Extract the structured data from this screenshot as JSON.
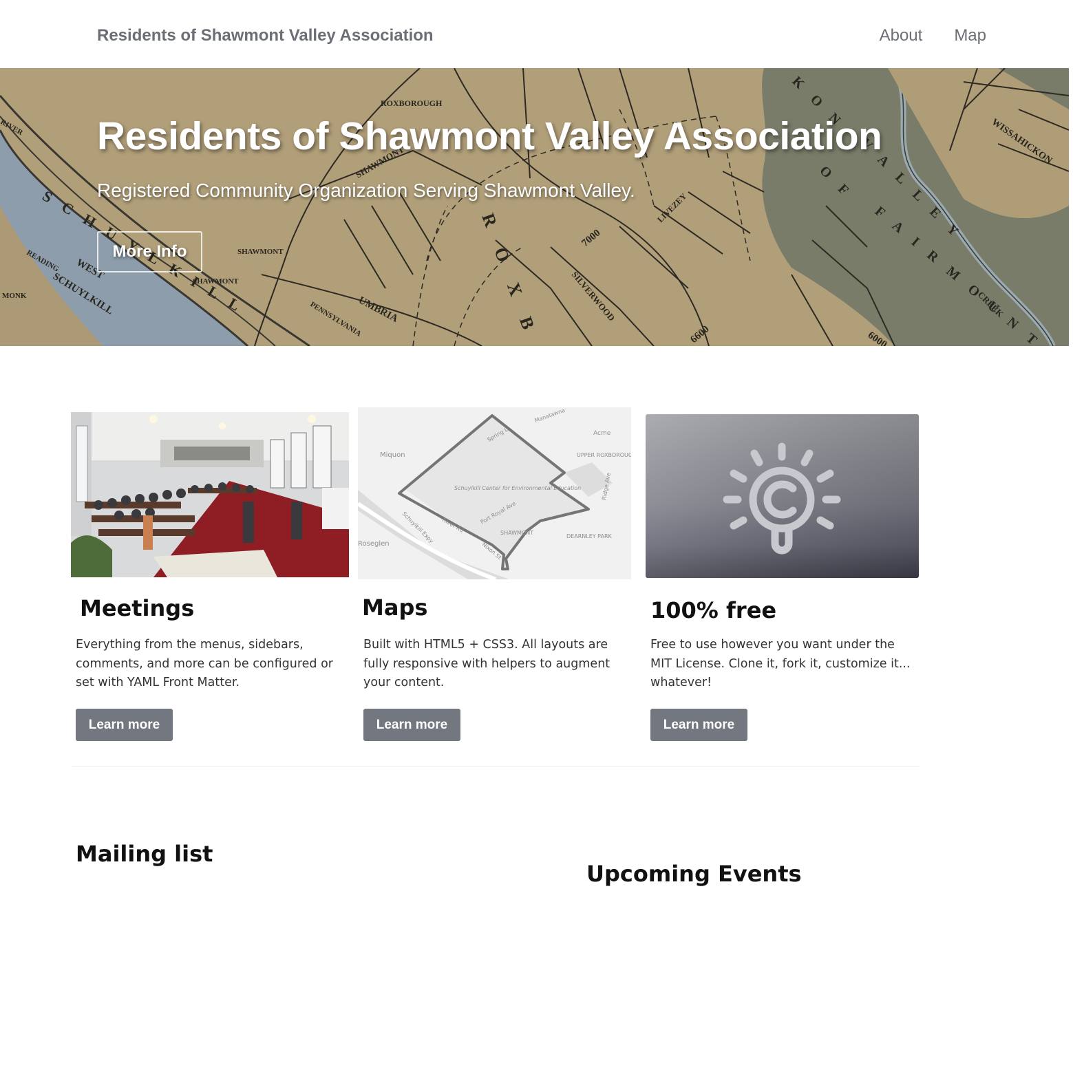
{
  "header": {
    "site_title": "Residents of Shawmont Valley Association",
    "nav": [
      {
        "label": "About"
      },
      {
        "label": "Map"
      }
    ]
  },
  "hero": {
    "title": "Residents of Shawmont Valley Association",
    "subtitle": "Registered Community Organization Serving Shawmont Valley.",
    "button_label": "More Info",
    "map_labels": {
      "shawmont": "SHAWMONT",
      "roxborough": "ROXBOROUGH",
      "schuylkill": "SCHUYLKILL",
      "river": "RIVER",
      "fairmount": "FAIRMOUNT",
      "valley": "VALLEY",
      "kon": "KON",
      "of": "OF",
      "creek": "CREEK",
      "umbria": "UMBRIA",
      "west": "WEST",
      "reading": "READING",
      "monk": "MONK",
      "livezey": "LIVEZEY",
      "wissahickon": "WISSAHICKON",
      "pennsylvania": "PENNSYLVANIA",
      "silverwood": "SILVERWOOD",
      "n7000": "7000",
      "n6600": "6600",
      "n6000": "6000"
    }
  },
  "features": [
    {
      "title": "Meetings",
      "text": "Everything from the menus, sidebars, comments, and more can be configured or set with YAML Front Matter.",
      "button_label": "Learn more"
    },
    {
      "title": "Maps",
      "text": "Built with HTML5 + CSS3. All layouts are fully responsive with helpers to augment your content.",
      "button_label": "Learn more",
      "map_labels": {
        "miquon": "Miquon",
        "roseglen": "Roseglen",
        "acme": "Acme",
        "upper_roxborough": "UPPER ROXBOROUGH",
        "center": "Schuylkill Center for Environmental Education",
        "port_royal": "Port Royal Ave",
        "shawmont": "SHAWMONT",
        "dearnley": "DEARNLEY PARK",
        "ridge": "Ridge Ave",
        "river_rd": "River Rd",
        "schuylkill_expy": "Schuylkill Expy",
        "nixon": "Nixon St",
        "spring": "Spring L",
        "manatawna": "Manatawna"
      }
    },
    {
      "title": "100% free",
      "text": "Free to use however you want under the MIT License. Clone it, fork it, customize it... whatever!",
      "button_label": "Learn more"
    }
  ],
  "sections": {
    "mailing_list": "Mailing list",
    "upcoming_events": "Upcoming Events"
  },
  "colors": {
    "nav_text": "#6b6f75",
    "button_bg": "#737780",
    "map_paper": "#b8a47c",
    "river": "#8fa2b4",
    "park": "#7d806c"
  }
}
